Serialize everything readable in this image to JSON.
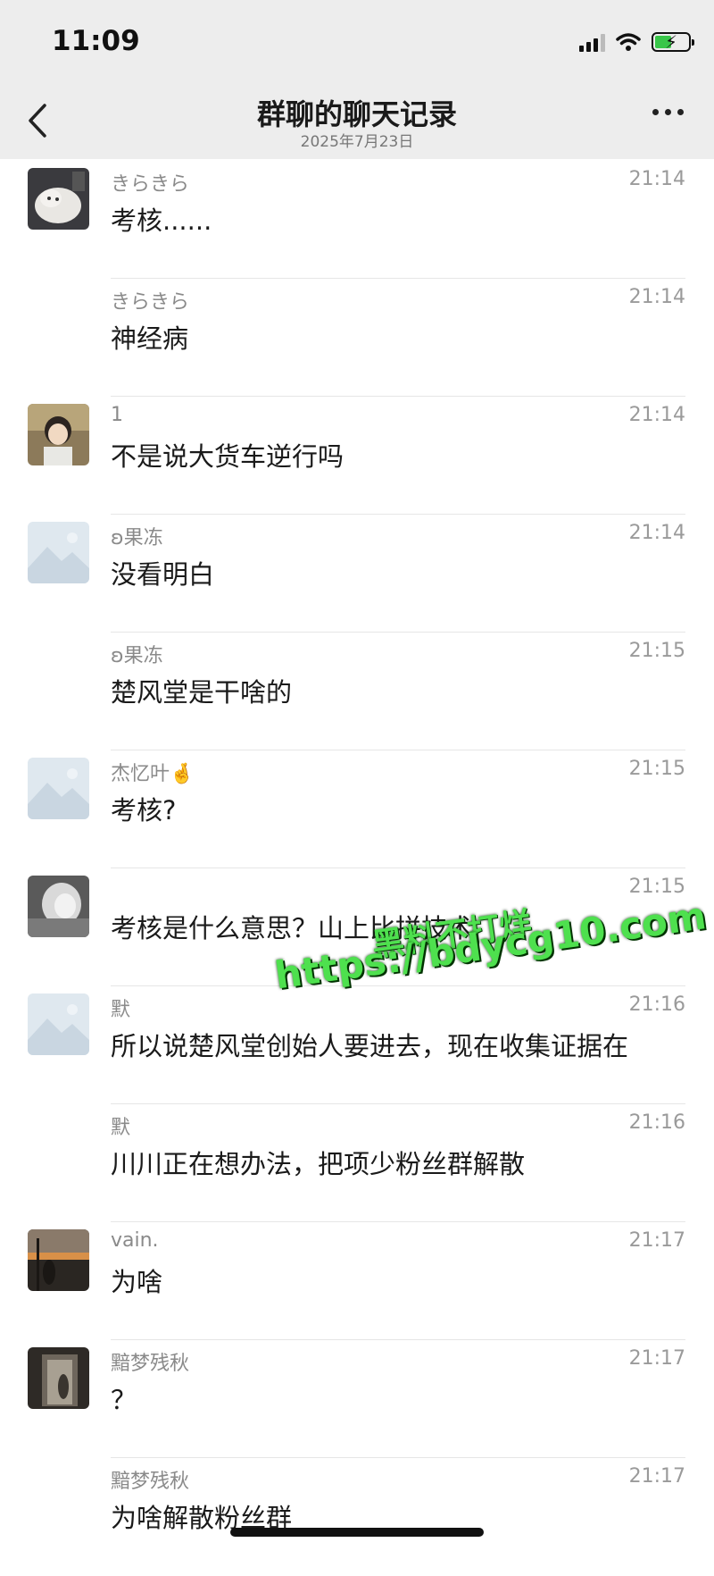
{
  "status_bar": {
    "time": "11:09"
  },
  "header": {
    "title": "群聊的聊天记录",
    "subtitle": "2025年7月23日"
  },
  "messages": [
    {
      "sender": "きらきら",
      "time": "21:14",
      "text": "考核......",
      "avatar": "cat-photo"
    },
    {
      "sender": "きらきら",
      "time": "21:14",
      "text": "神经病",
      "avatar": ""
    },
    {
      "sender": "1",
      "time": "21:14",
      "text": "不是说大货车逆行吗",
      "avatar": "anime-boy"
    },
    {
      "sender": "ʚ果冻",
      "time": "21:14",
      "text": "没看明白",
      "avatar": "placeholder-image"
    },
    {
      "sender": "ʚ果冻",
      "time": "21:15",
      "text": "楚风堂是干啥的",
      "avatar": ""
    },
    {
      "sender": "杰忆叶🤞",
      "time": "21:15",
      "text": "考核?",
      "avatar": "placeholder-image"
    },
    {
      "sender": "",
      "time": "21:15",
      "text": "考核是什么意思？山上比拼技术",
      "avatar": "grayscale-portrait"
    },
    {
      "sender": "默",
      "time": "21:16",
      "text": "所以说楚风堂创始人要进去，现在收集证据在",
      "avatar": "placeholder-image"
    },
    {
      "sender": "默",
      "time": "21:16",
      "text": "川川正在想办法，把项少粉丝群解散",
      "avatar": ""
    },
    {
      "sender": "vain.",
      "time": "21:17",
      "text": "为啥",
      "avatar": "sunset-street"
    },
    {
      "sender": "黯梦残秋",
      "time": "21:17",
      "text": "？",
      "avatar": "dark-doorway"
    },
    {
      "sender": "黯梦残秋",
      "time": "21:17",
      "text": "为啥解散粉丝群",
      "avatar": ""
    }
  ],
  "watermark": {
    "line1": "黑料不打烊",
    "line2": "https://bdycg10.com",
    "color": "#4ee04e"
  },
  "colors": {
    "header_bg": "#ededed",
    "battery_fill": "#39c649"
  }
}
